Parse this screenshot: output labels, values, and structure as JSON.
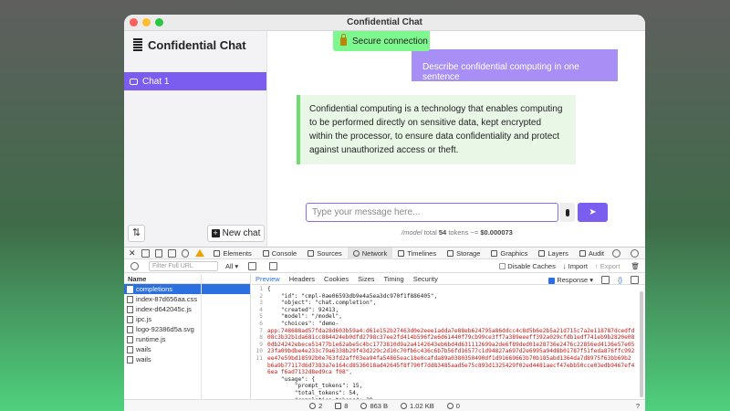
{
  "window": {
    "title": "Confidential Chat"
  },
  "sidebar": {
    "brand": "Confidential Chat",
    "chats": [
      {
        "label": "Chat 1",
        "active": true
      }
    ],
    "sort_icon": "⇅",
    "new_chat_label": "New chat"
  },
  "main": {
    "secure_badge": "Secure connection",
    "user_message": "Describe confidential computing in one sentence",
    "bot_message": "Confidential computing is a technology that enables computing to be performed directly on sensitive data, kept encrypted within the processor, to ensure data confidentiality and protect against unauthorized access or theft.",
    "input_placeholder": "Type your message here...",
    "send_icon": "➤",
    "stats": {
      "model": "/model",
      "total_label": "total",
      "tokens": "54",
      "tokens_label": "tokens ~=",
      "cost": "$0.000073"
    }
  },
  "devtools": {
    "tabs": [
      "Elements",
      "Console",
      "Sources",
      "Network",
      "Timelines",
      "Storage",
      "Graphics",
      "Layers",
      "Audit"
    ],
    "active_tab": "Network",
    "filter_placeholder": "Filter Full URL",
    "type_filter": "All",
    "disable_caches": "Disable Caches",
    "import": "Import",
    "export": "Export",
    "list_header": "Name",
    "files": [
      "completions",
      "index-87d656aa.css",
      "index-d642045c.js",
      "ipc.js",
      "logo-92386d5a.svg",
      "runtime.js",
      "wails",
      "wails"
    ],
    "response_tabs": [
      "Preview",
      "Headers",
      "Cookies",
      "Sizes",
      "Timing",
      "Security"
    ],
    "response_mode": "Response",
    "code_lines": [
      "{",
      "    \"id\": \"cmpl-0ae06593db9e4a5ea3dc970f1f886405\",",
      "    \"object\": \"chat.completion\",",
      "    \"created\": 92413,",
      "    \"model\": \"/model\",",
      "    \"choices\": \"demo-",
      "app:748688ad57fda28d603b59a4:d61e152b27463d0e2eee1adda7e88eb624795a86ddcc4c8d5b6e2b5a21d715c7a2e118787dcedfd",
      "08c3b32b1da681cc884424eb0dfd2798c37ee2fd414b596f2e6d61440f79cb99ce3ff7a389eeeff392a029cfdb1edf741eb9b2820e08",
      "0db24242ebece51477b1e62abe5c4bc1773810d9a2a4142643eb6bd4d631112699a2de6f89ded01e28736e2476c22856ed4136e57e05",
      "23fa09bdbe4e233c79a6338b29f43d229c2d10c70fb6c436c6b7b56fd16577c1d94827a697d2e6995a94d8b01787f51feda876ffc992",
      "ee47e59bd18592b0e763fd2aff03ea94fa54865eac18e0cafda89a0380350490df1d91669663b70b185abd1364da7d8975f63bb69b2",
      "b6a9b77117d6d7383a7e164cd8536018ad42645f8f790f7dd83485aad5e75c893d1325429f02ed4481aecf47ebb50cce03edb9467ef4",
      "6ea f6ad7132d8ed9ca f08\",",
      "    \"usage\": {",
      "        \"prompt_tokens\": 15,",
      "        \"total_tokens\": 54,",
      "        \"completion_tokens\": 39",
      "    },"
    ],
    "line_numbers": [
      "1",
      "2",
      "3",
      "4",
      "5",
      "6",
      "",
      "",
      "",
      "",
      "",
      "",
      "",
      "7",
      "8",
      "9",
      "10",
      "11"
    ],
    "status": {
      "requests": "2",
      "resources": "8",
      "transferred": "863 B",
      "size": "1.02 KB",
      "errors": "0",
      "help": "?"
    }
  },
  "colors": {
    "accent": "#7b5df0",
    "secure_green": "#7ef78e",
    "bot_bg": "#e9f8e6"
  }
}
